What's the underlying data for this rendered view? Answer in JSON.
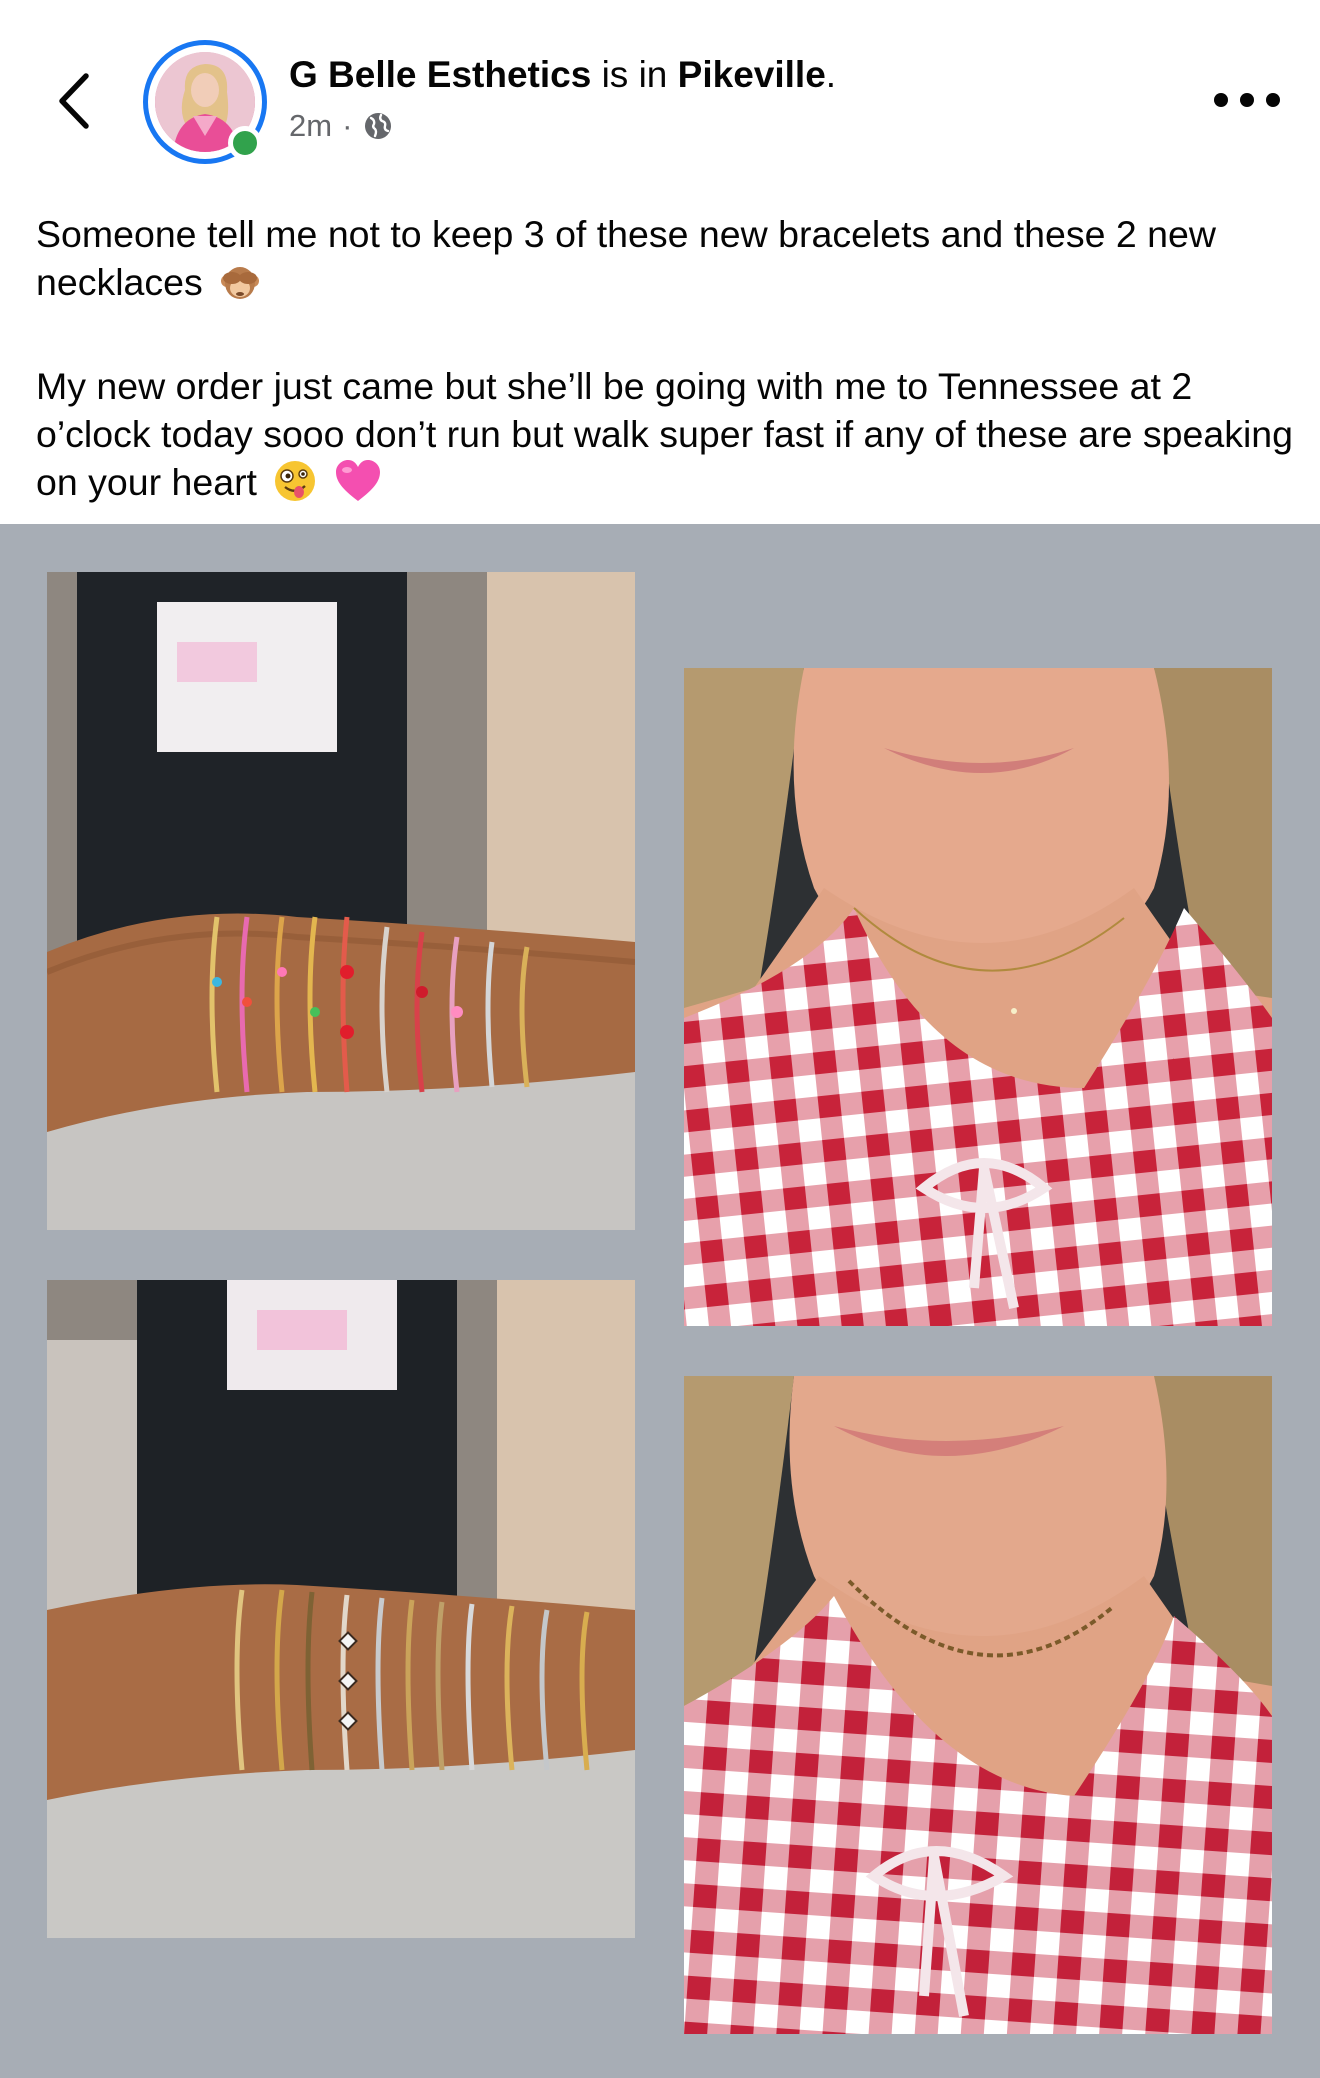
{
  "post": {
    "author": "G Belle Esthetics",
    "location_connector": "is in",
    "location": "Pikeville",
    "location_punct": ".",
    "time": "2m",
    "meta_separator": "·",
    "audience_icon": "globe-icon",
    "text_line1": "Someone tell me not to keep 3 of these new bracelets and these 2 new necklaces",
    "text_line2": "My new order just came but she’ll be going with me to Tennessee at 2 o’clock today sooo don’t run but walk super fast if any of these are speaking on your heart"
  },
  "icons": {
    "back": "chevron-left-icon",
    "more": "more-options-icon",
    "emoji1": "see-no-evil-monkey-emoji",
    "emoji2": "zany-face-emoji",
    "emoji3": "pink-heart-emoji"
  },
  "gallery": {
    "photos": [
      "bracelets-colorful",
      "necklace-dainty",
      "bracelets-gold-silver",
      "necklace-beaded"
    ]
  },
  "colors": {
    "accent": "#1877f2",
    "online": "#31a24c",
    "gallery_bg": "#a7adb5",
    "secondary_text": "#65676b",
    "gingham_red": "#c8233a"
  }
}
